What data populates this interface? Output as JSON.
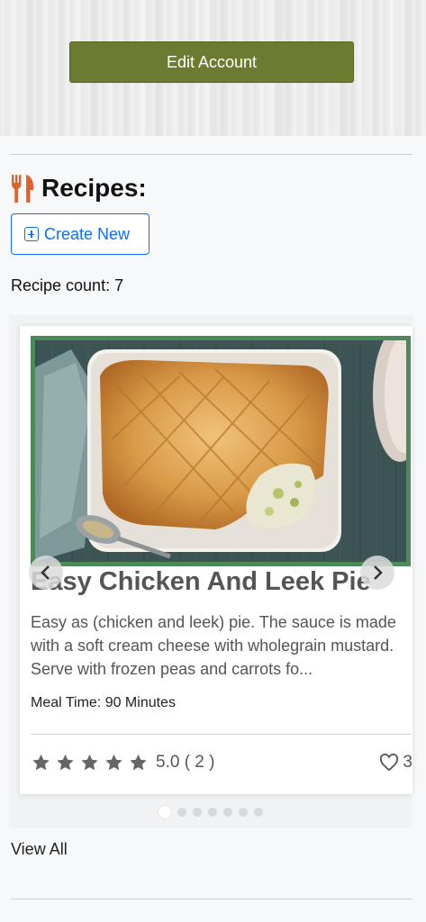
{
  "header": {
    "edit_account_label": "Edit Account"
  },
  "recipes": {
    "title": "Recipes:",
    "title_icon": "fork-knife-icon",
    "create_new_label": "Create New",
    "count_text": "Recipe count: 7",
    "view_all_label": "View All"
  },
  "card": {
    "title": "Easy Chicken And Leek Pie",
    "description": "Easy as (chicken and leek) pie. The sauce is made with a soft cream cheese with wholegrain mustard. Serve with frozen peas and carrots fo...",
    "meal_time": "Meal Time: 90 Minutes",
    "rating_stars": 5,
    "rating_text": "5.0 ( 2 )",
    "likes": "3",
    "image_alt": "chicken-leek-pie-photo"
  },
  "carousel": {
    "slide_count": 7,
    "active_index": 0
  },
  "colors": {
    "edit_button": "#6b7c32",
    "accent_blue": "#0d6efd",
    "icon_orange": "#e0622a",
    "image_border": "#4c8a5a"
  }
}
